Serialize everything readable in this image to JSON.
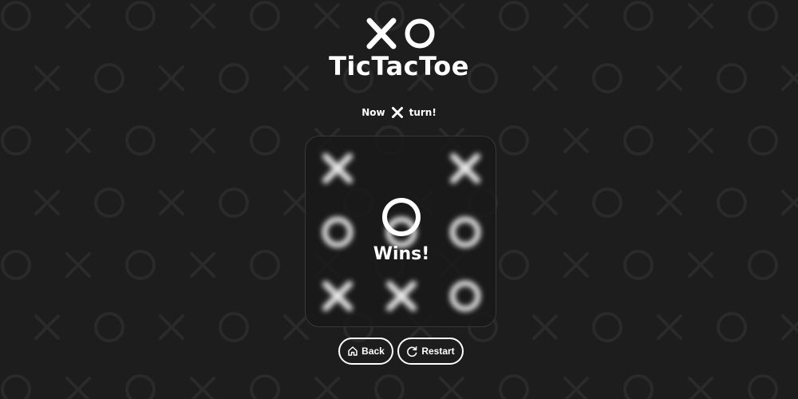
{
  "app": {
    "title": "TicTacToe",
    "logo_icons": [
      "x-icon",
      "o-icon"
    ]
  },
  "status": {
    "prefix": "Now",
    "player_icon": "x-icon",
    "suffix": "turn!"
  },
  "board": {
    "cells": [
      "X",
      "",
      "X",
      "O",
      "O",
      "O",
      "X",
      "X",
      "O"
    ],
    "blurred": true
  },
  "result": {
    "winner_icon": "o-icon",
    "label": "Wins!"
  },
  "buttons": {
    "back_label": "Back",
    "back_icon": "home-icon",
    "restart_label": "Restart",
    "restart_icon": "restart-icon"
  },
  "colors": {
    "background": "#1d1d1d",
    "foreground": "#ffffff",
    "board_border": "#383838",
    "pattern": "#2a2a2a"
  }
}
